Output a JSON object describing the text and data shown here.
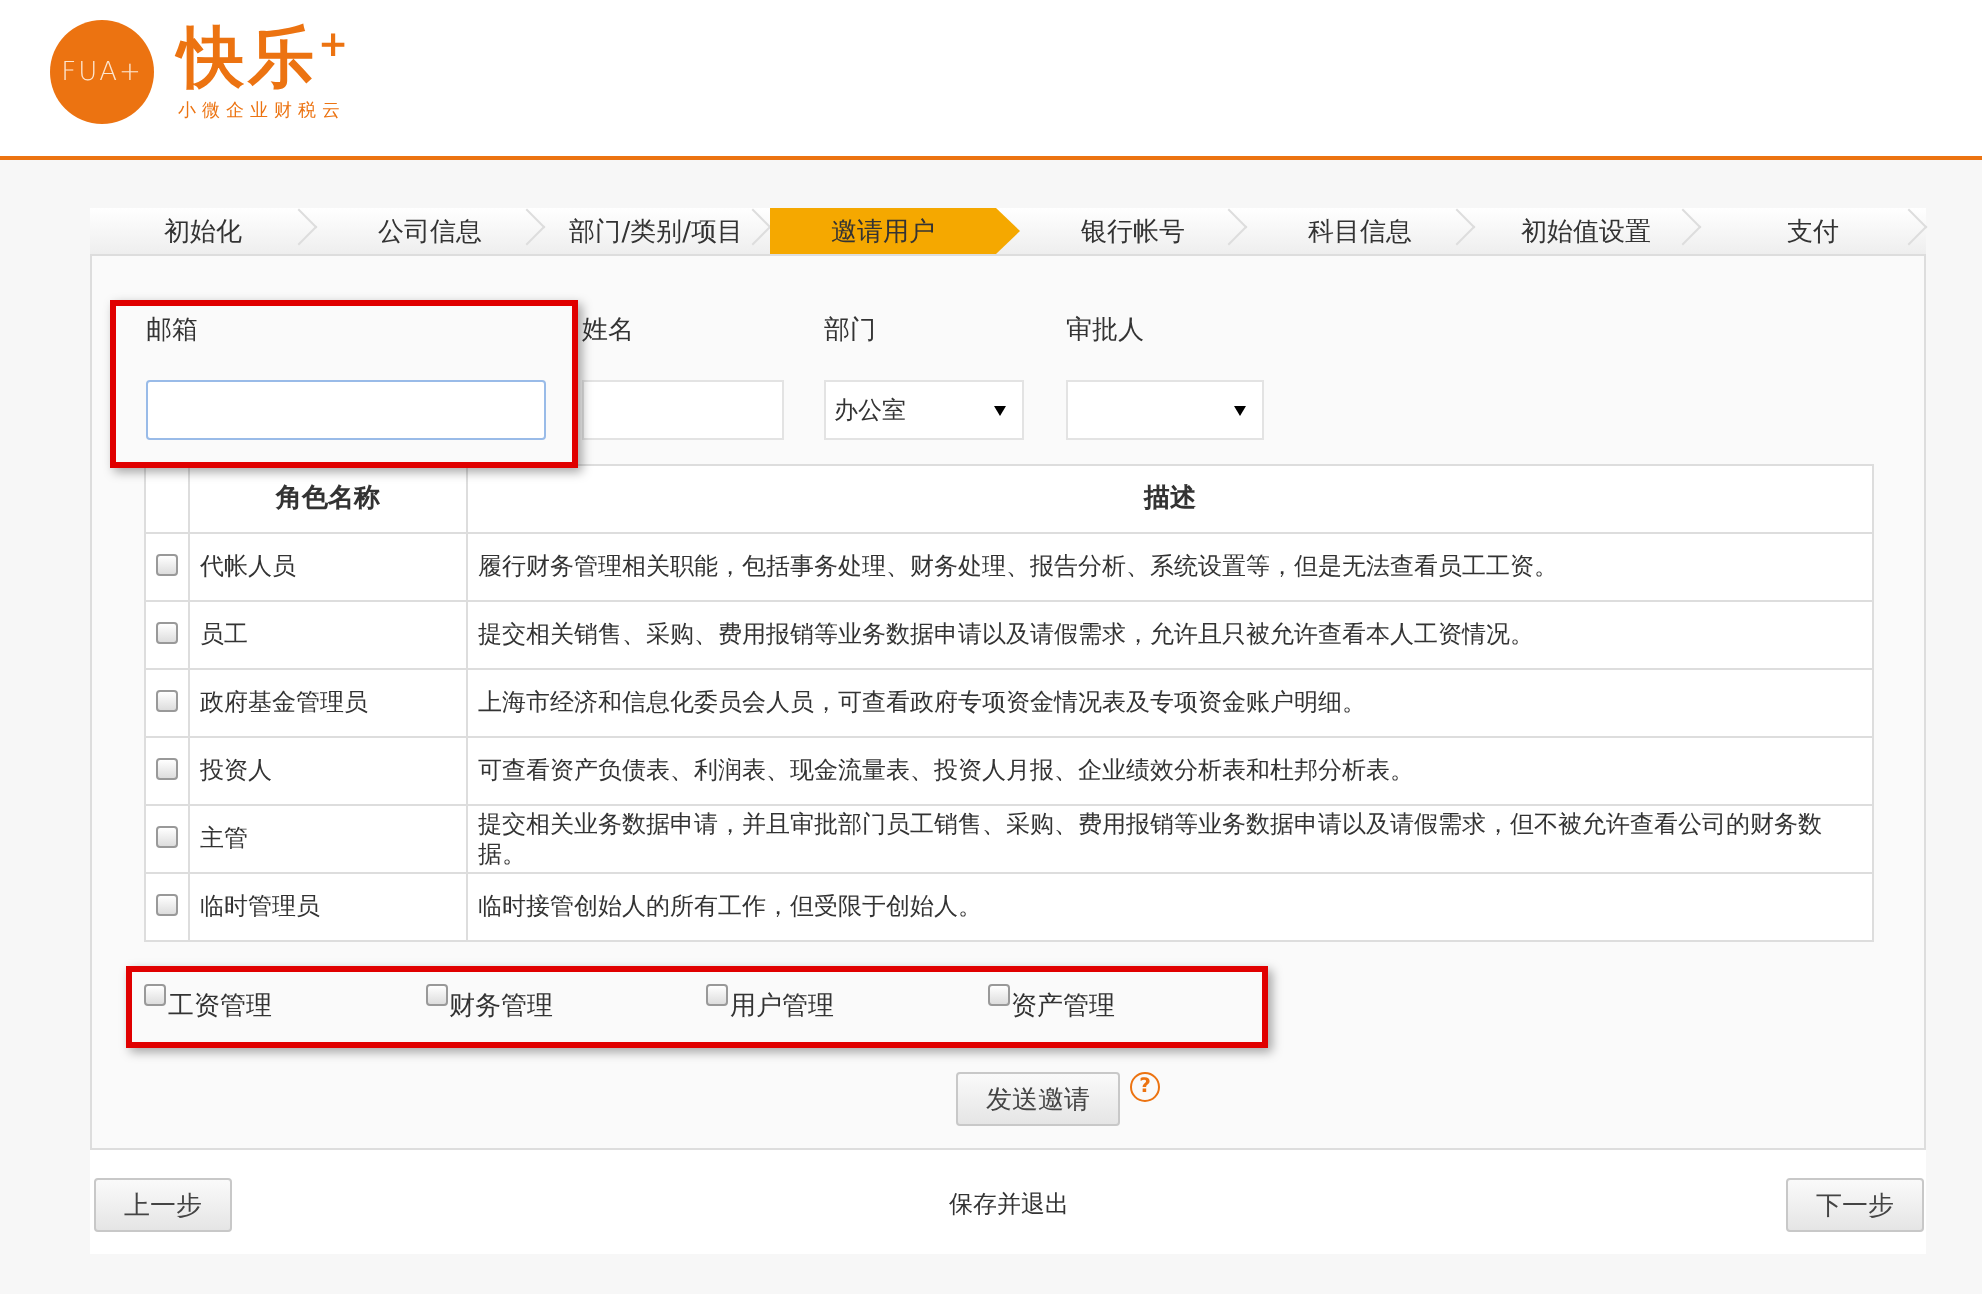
{
  "logo": {
    "mark": "FUA+",
    "brand": "快乐",
    "brand_sup": "+",
    "tagline": "小微企业财税云"
  },
  "steps": [
    {
      "label": "初始化",
      "selected": false
    },
    {
      "label": "公司信息",
      "selected": false
    },
    {
      "label": "部门/类别/项目",
      "selected": false
    },
    {
      "label": "邀请用户",
      "selected": true
    },
    {
      "label": "银行帐号",
      "selected": false
    },
    {
      "label": "科目信息",
      "selected": false
    },
    {
      "label": "初始值设置",
      "selected": false
    },
    {
      "label": "支付",
      "selected": false
    }
  ],
  "form": {
    "email": {
      "label": "邮箱",
      "highlighted": true
    },
    "name": {
      "label": "姓名"
    },
    "department": {
      "label": "部门",
      "value": "办公室"
    },
    "approver": {
      "label": "审批人"
    }
  },
  "table": {
    "columns": [
      "角色名称",
      "描述"
    ],
    "rows": [
      {
        "checked": false,
        "role": "代帐人员",
        "description": "履行财务管理相关职能，包括事务处理、财务处理、报告分析、系统设置等，但是无法查看员工工资。"
      },
      {
        "checked": false,
        "role": "员工",
        "description": "提交相关销售、采购、费用报销等业务数据申请以及请假需求，允许且只被允许查看本人工资情况。"
      },
      {
        "checked": false,
        "role": "政府基金管理员",
        "description": "上海市经济和信息化委员会人员，可查看政府专项资金情况表及专项资金账户明细。"
      },
      {
        "checked": false,
        "role": "投资人",
        "description": "可查看资产负债表、利润表、现金流量表、投资人月报、企业绩效分析表和杜邦分析表。"
      },
      {
        "checked": false,
        "role": "主管",
        "description": "提交相关业务数据申请，并且审批部门员工销售、采购、费用报销等业务数据申请以及请假需求，但不被允许查看公司的财务数据。"
      },
      {
        "checked": false,
        "role": "临时管理员",
        "description": "临时接管创始人的所有工作，但受限于创始人。"
      }
    ]
  },
  "permissions": {
    "highlighted": true,
    "items": [
      {
        "label": "工资管理",
        "checked": false
      },
      {
        "label": "财务管理",
        "checked": false
      },
      {
        "label": "用户管理",
        "checked": false
      },
      {
        "label": "资产管理",
        "checked": false
      }
    ]
  },
  "send_button": "发送邀请",
  "help_icon": "?",
  "footer": {
    "prev": "上一步",
    "save_exit": "保存并退出",
    "next": "下一步"
  }
}
